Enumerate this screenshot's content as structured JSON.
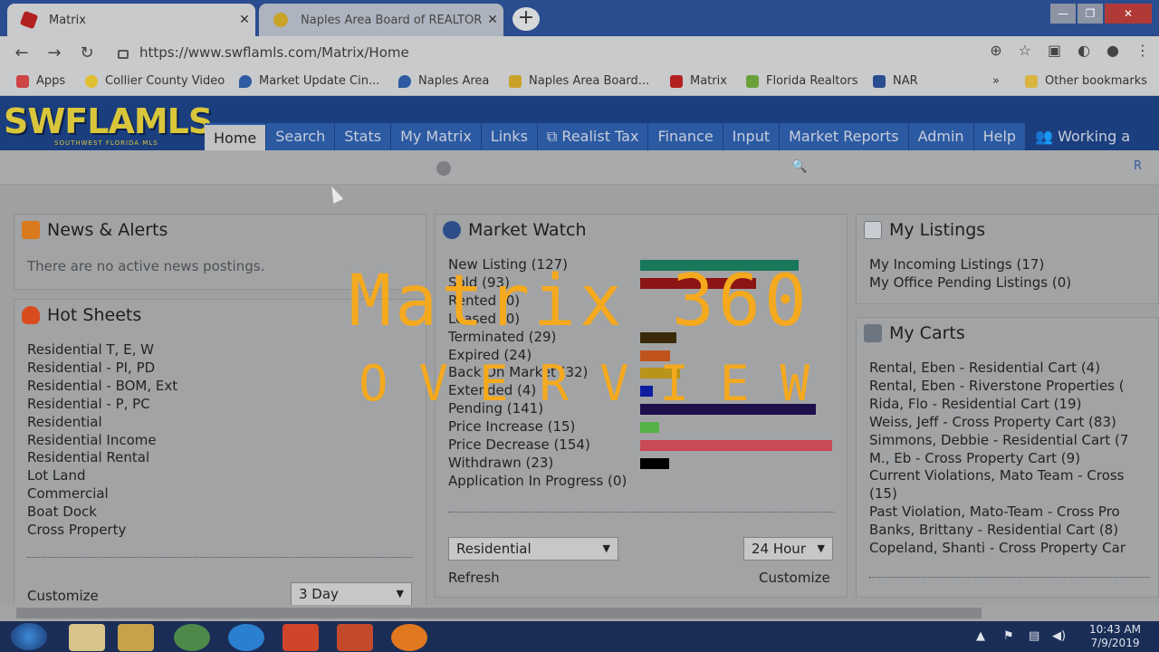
{
  "browser": {
    "tabs": [
      {
        "title": "Matrix",
        "active": true
      },
      {
        "title": "Naples Area Board of REALTORS",
        "active": false
      }
    ],
    "new_tab_label": "+",
    "url": "https://www.swflamls.com/Matrix/Home",
    "window": {
      "minimize": "—",
      "maximize": "❐",
      "close": "✕"
    },
    "bookmarks": [
      {
        "label": "Apps"
      },
      {
        "label": "Collier County Video"
      },
      {
        "label": "Market Update Cin..."
      },
      {
        "label": "Naples Area"
      },
      {
        "label": "Naples Area Board..."
      },
      {
        "label": "Matrix"
      },
      {
        "label": "Florida Realtors"
      },
      {
        "label": "NAR"
      },
      {
        "label": "»"
      },
      {
        "label": "Other bookmarks"
      }
    ]
  },
  "mls": {
    "logo": "SWFLAMLS",
    "logo_sub": "SOUTHWEST FLORIDA MLS",
    "nav": [
      "Home",
      "Search",
      "Stats",
      "My Matrix",
      "Links",
      "Realist Tax",
      "Finance",
      "Input",
      "Market Reports",
      "Admin",
      "Help",
      "Working a"
    ],
    "sub_right": "R"
  },
  "news": {
    "title": "News & Alerts",
    "empty": "There are no active news postings."
  },
  "hot_sheets": {
    "title": "Hot Sheets",
    "items": [
      "Residential T, E, W",
      "Residential - PI, PD",
      "Residential - BOM, Ext",
      "Residential - P, PC",
      "Residential",
      "Residential Income",
      "Residential Rental",
      "Lot Land",
      "Commercial",
      "Boat Dock",
      "Cross Property"
    ],
    "customize": "Customize",
    "period": "3 Day"
  },
  "market_watch": {
    "title": "Market Watch",
    "items": [
      {
        "label": "New Listing (127)",
        "value": 127,
        "color": "#17785a"
      },
      {
        "label": "Sold (93)",
        "value": 93,
        "color": "#8b1414"
      },
      {
        "label": "Rented (0)",
        "value": 0,
        "color": "#666666"
      },
      {
        "label": "Leased (0)",
        "value": 0,
        "color": "#666666"
      },
      {
        "label": "Terminated (29)",
        "value": 29,
        "color": "#3a2a08"
      },
      {
        "label": "Expired (24)",
        "value": 24,
        "color": "#c1531c"
      },
      {
        "label": "Back On Market (32)",
        "value": 32,
        "color": "#b8941a"
      },
      {
        "label": "Extended (4)",
        "value": 4,
        "color": "#0d1fa0"
      },
      {
        "label": "Pending (141)",
        "value": 141,
        "color": "#1c0f4a"
      },
      {
        "label": "Price Increase (15)",
        "value": 15,
        "color": "#55b247"
      },
      {
        "label": "Price Decrease (154)",
        "value": 154,
        "color": "#c94a55"
      },
      {
        "label": "Withdrawn (23)",
        "value": 23,
        "color": "#000000"
      },
      {
        "label": "Application In Progress (0)",
        "value": 0,
        "color": "#666666"
      }
    ],
    "property_type": "Residential",
    "period": "24 Hour",
    "refresh": "Refresh",
    "customize": "Customize"
  },
  "my_listings": {
    "title": "My Listings",
    "items": [
      "My Incoming Listings (17)",
      "My Office Pending Listings (0)"
    ]
  },
  "my_carts": {
    "title": "My Carts",
    "items": [
      "Rental, Eben - Residential Cart (4)",
      "Rental, Eben - Riverstone Properties (",
      "Rida, Flo - Residential Cart (19)",
      "Weiss, Jeff - Cross Property Cart (83)",
      "Simmons, Debbie - Residential Cart (7",
      "M., Eb - Cross Property Cart (9)",
      "Current Violations, Mato Team - Cross",
      "(15)",
      "Past Violation, Mato-Team - Cross Pro",
      "Banks, Brittany - Residential Cart (8)",
      "Copeland, Shanti - Cross Property Car"
    ]
  },
  "overlay": {
    "line1": "Matrix 360",
    "line2": "OVERVIEW"
  },
  "taskbar": {
    "time": "10:43 AM",
    "date": "7/9/2019"
  }
}
